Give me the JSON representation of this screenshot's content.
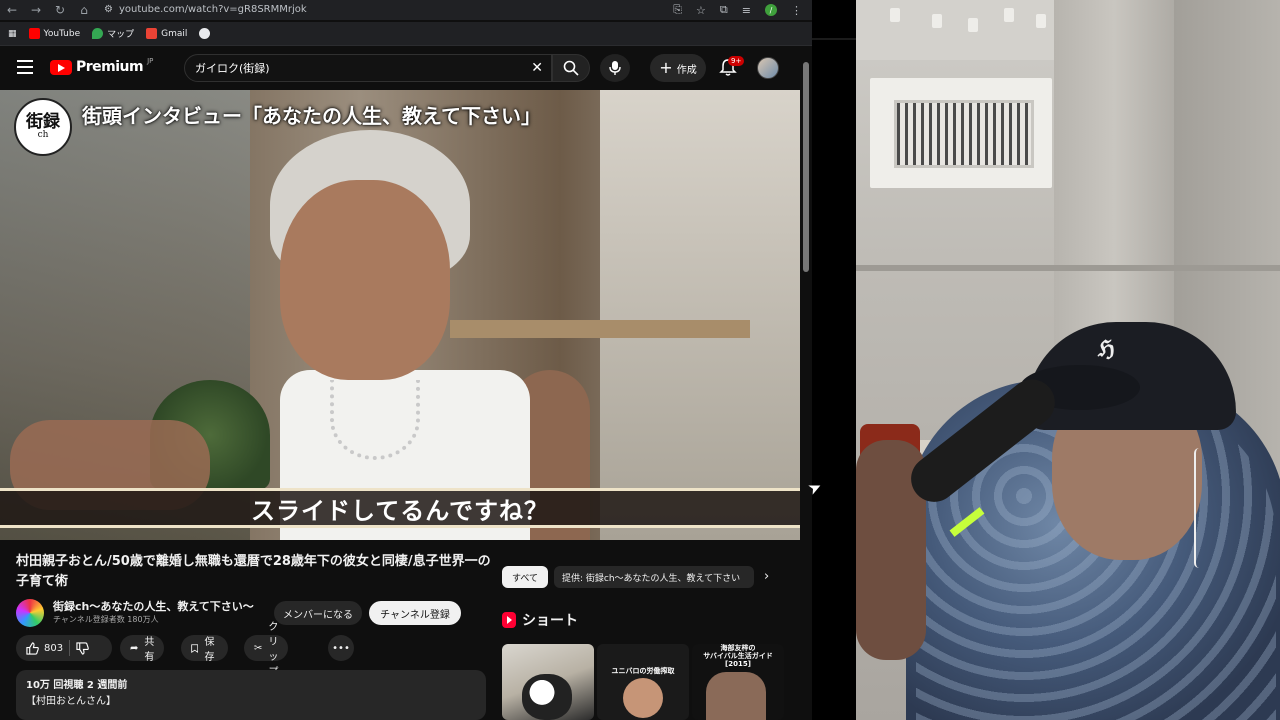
{
  "browser": {
    "url": "youtube.com/watch?v=gR8SRMMrjok",
    "profile_initial": "/"
  },
  "bookmarks": [
    {
      "label": "YouTube",
      "color": "#ff0000"
    },
    {
      "label": "マップ",
      "color": "#34a853"
    },
    {
      "label": "Gmail",
      "color": "#ea4335"
    }
  ],
  "youtube": {
    "brand": "Premium",
    "region": "JP",
    "search_value": "ガイロク(街録)",
    "create_label": "作成",
    "notification_badge": "9+"
  },
  "player": {
    "channel_logo_main": "街録",
    "channel_logo_sub": "ch",
    "overlay_title": "街頭インタビュー「あなたの人生、教えて下さい」",
    "subtitle": "スライドしてるんですね？"
  },
  "video": {
    "title": "村田親子おとん/50歳で離婚し無職も還暦で28歳年下の彼女と同棲/息子世界一の子育て術",
    "channel_name": "街録ch〜あなたの人生、教えて下さい〜",
    "subscribers": "チャンネル登録者数 180万人",
    "member_label": "メンバーになる",
    "subscribe_label": "チャンネル登録",
    "likes": "803",
    "share_label": "共有",
    "save_label": "保存",
    "clip_label": "クリップ",
    "more_label": "•••",
    "views_date": "10万 回視聴  2 週間前",
    "desc_line": "【村田おとんさん】"
  },
  "sidebar": {
    "chip_all": "すべて",
    "chip_by": "提供: 街録ch〜あなたの人生、教えて下さい",
    "shorts_label": "ショート",
    "short_captions": [
      "",
      "ユニバロの労働搾取",
      "海部友梓の\nサバイバル生活ガイド\n[2015]"
    ]
  }
}
